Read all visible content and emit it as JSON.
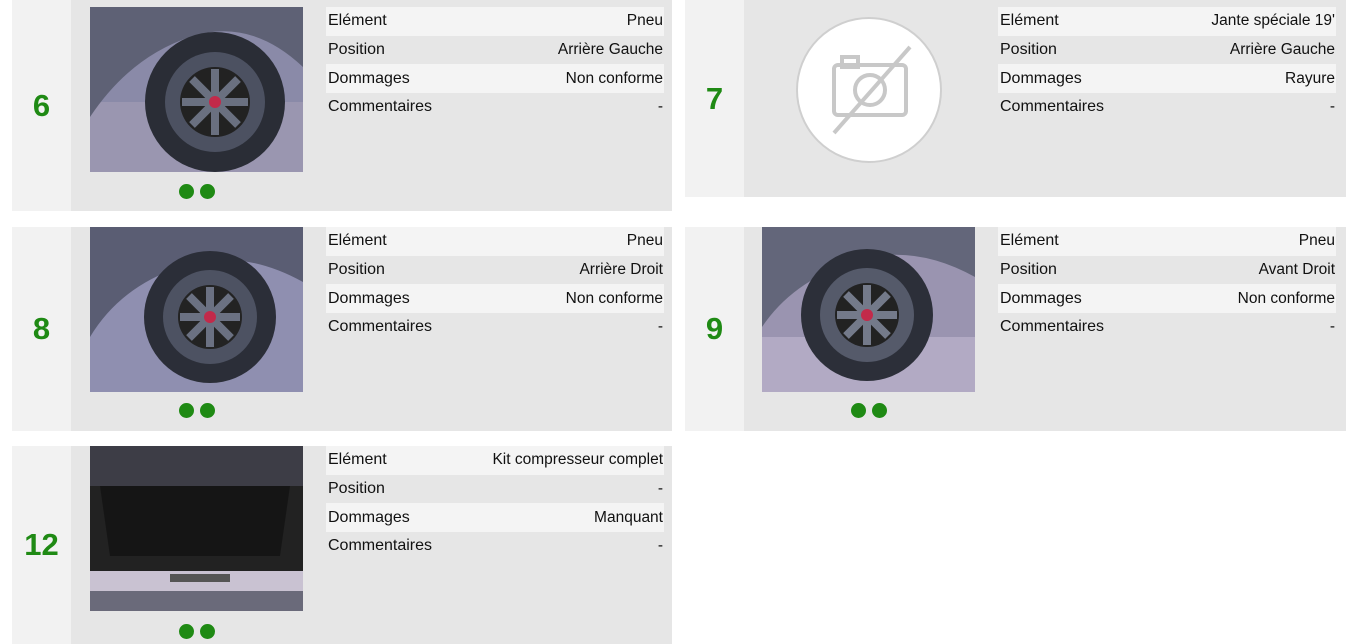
{
  "labels": {
    "element": "Elément",
    "position": "Position",
    "dommages": "Dommages",
    "commentaires": "Commentaires"
  },
  "colors": {
    "accent": "#1f8a14",
    "card_bg": "#e6e6e6",
    "row_alt": "#f4f4f4"
  },
  "items": [
    {
      "number": "6",
      "element": "Pneu",
      "position": "Arrière Gauche",
      "dommages": "Non conforme",
      "commentaires": "-",
      "photo": "wheel-photo",
      "photo_count": 2
    },
    {
      "number": "7",
      "element": "Jante spéciale 19'",
      "position": "Arrière Gauche",
      "dommages": "Rayure",
      "commentaires": "-",
      "photo": "no-photo-icon",
      "photo_count": 0
    },
    {
      "number": "8",
      "element": "Pneu",
      "position": "Arrière Droit",
      "dommages": "Non conforme",
      "commentaires": "-",
      "photo": "wheel-photo",
      "photo_count": 2
    },
    {
      "number": "9",
      "element": "Pneu",
      "position": "Avant Droit",
      "dommages": "Non conforme",
      "commentaires": "-",
      "photo": "wheel-photo",
      "photo_count": 2
    },
    {
      "number": "12",
      "element": "Kit compresseur complet",
      "position": "-",
      "dommages": "Manquant",
      "commentaires": "-",
      "photo": "trunk-photo",
      "photo_count": 2
    }
  ]
}
